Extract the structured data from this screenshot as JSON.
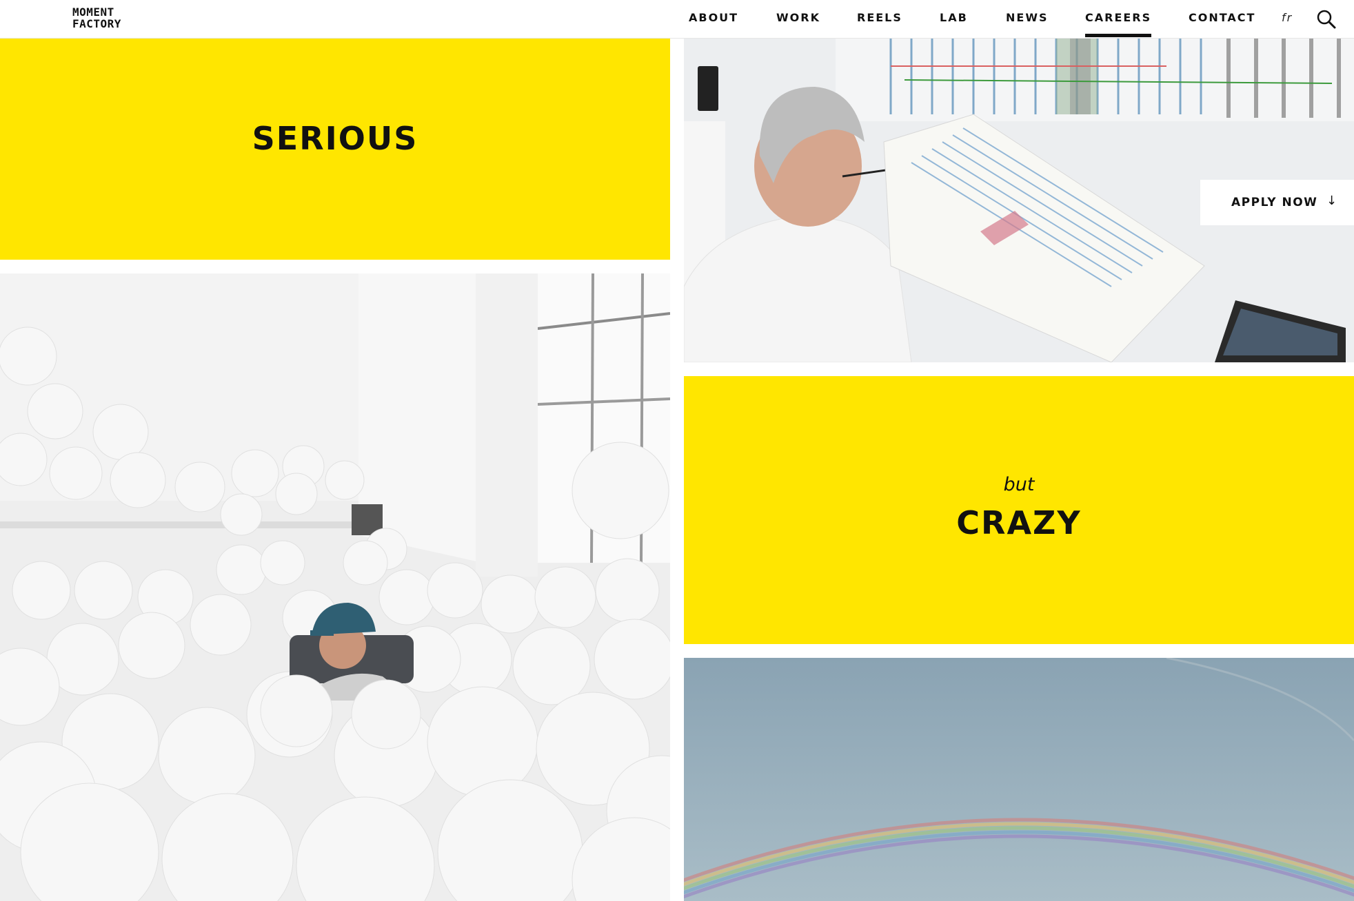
{
  "logo": {
    "line1": "MOMENT",
    "line2": "FACTORY"
  },
  "nav": {
    "items": [
      {
        "label": "ABOUT",
        "active": false
      },
      {
        "label": "WORK",
        "active": false
      },
      {
        "label": "REELS",
        "active": false
      },
      {
        "label": "LAB",
        "active": false
      },
      {
        "label": "NEWS",
        "active": false
      },
      {
        "label": "CAREERS",
        "active": true
      },
      {
        "label": "CONTACT",
        "active": false
      }
    ],
    "lang": "fr",
    "search_icon": "search-icon"
  },
  "hero": {
    "serious_word": "SERIOUS",
    "but_word": "but",
    "crazy_word": "CRAZY"
  },
  "apply": {
    "label": "APPLY NOW",
    "arrow": "↓",
    "arrow_icon": "arrow-down-icon"
  },
  "colors": {
    "accent_yellow": "#ffe600",
    "text": "#111111",
    "background": "#ffffff"
  }
}
